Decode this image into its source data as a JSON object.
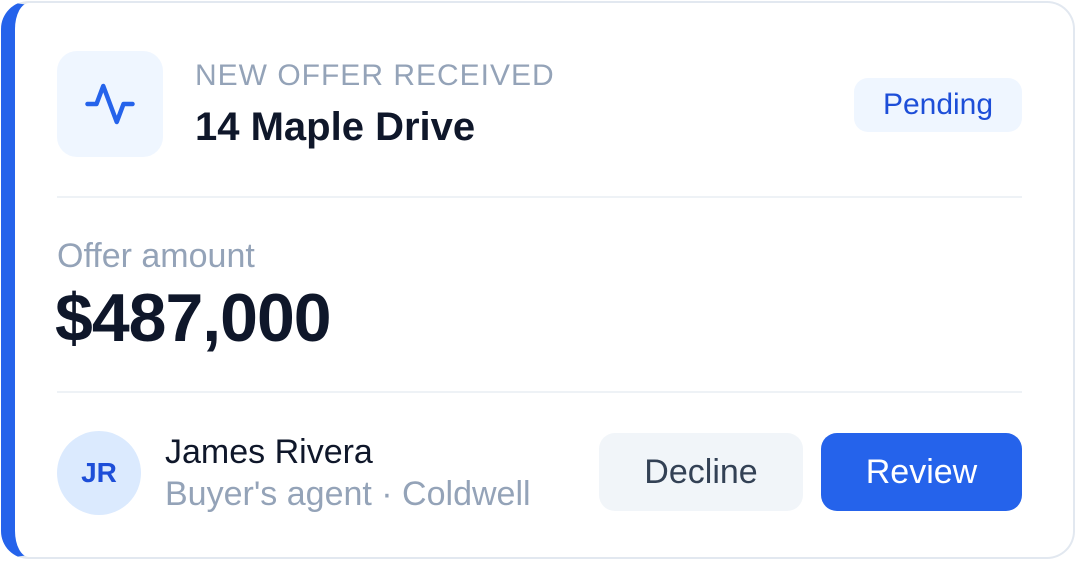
{
  "card": {
    "icon": "activity-pulse-icon",
    "eyebrow": "NEW OFFER RECEIVED",
    "title": "14 Maple Drive",
    "status_badge": "Pending"
  },
  "offer": {
    "label": "Offer amount",
    "amount": "$487,000"
  },
  "agent": {
    "initials": "JR",
    "name": "James Rivera",
    "role_company": "Buyer's agent · Coldwell"
  },
  "actions": {
    "decline_label": "Decline",
    "review_label": "Review"
  },
  "colors": {
    "accent": "#2563eb",
    "accent_light": "#eff6ff",
    "text_primary": "#0f172a",
    "text_muted": "#94a3b8"
  }
}
